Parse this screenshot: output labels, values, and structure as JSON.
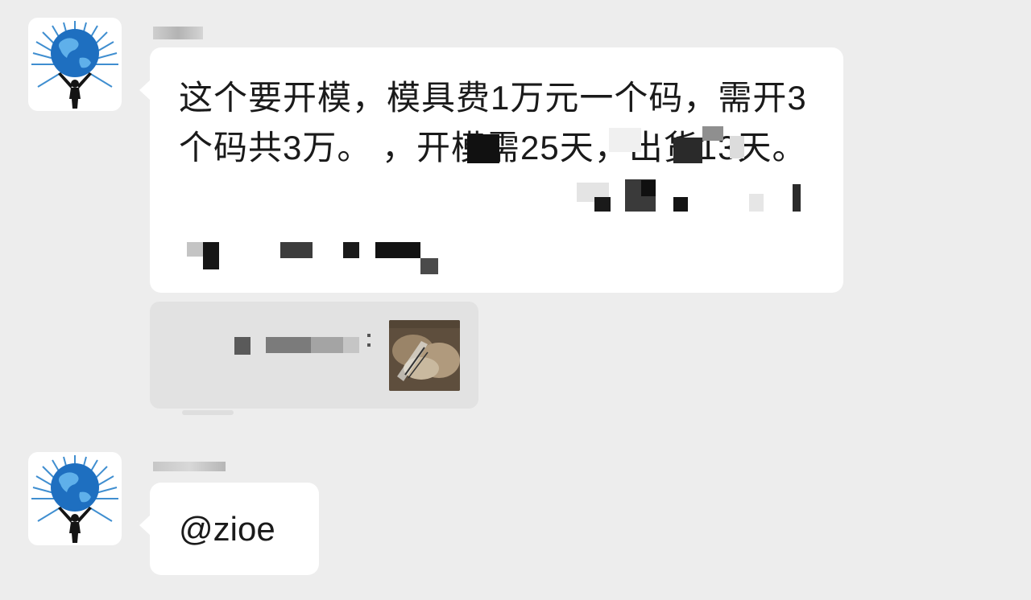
{
  "messages": [
    {
      "sender": "",
      "text": "这个要开模，模具费1万元一个码，需开3个码共3万。                       ，开模需25天，出货13天。"
    },
    {
      "sender": "",
      "text": "@zioe"
    }
  ],
  "colors": {
    "background": "#ededed",
    "bubble": "#ffffff",
    "quote_bg": "#e2e2e2",
    "mosaic_dark": "#1c1c1c",
    "mosaic_mid": "#6b6b6b"
  },
  "icons": {
    "avatar": "globe-atlas-icon",
    "quote_thumbnail": "shoe-package-photo"
  }
}
